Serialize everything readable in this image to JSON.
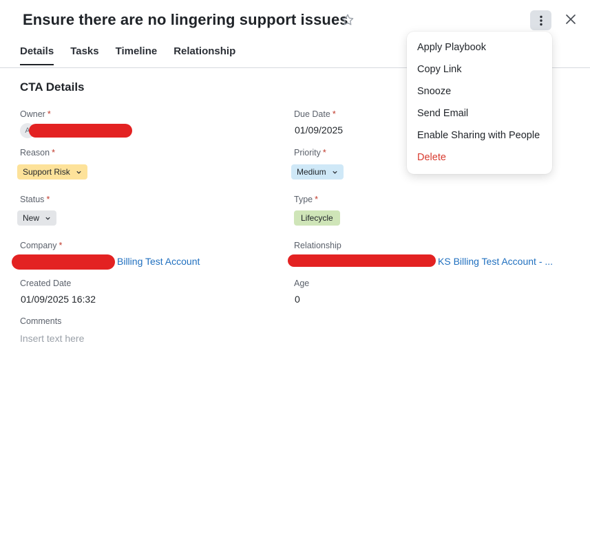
{
  "header": {
    "title": "Ensure there are no lingering support issues",
    "star_icon": "star-outline-icon",
    "more_icon": "more-vertical-icon",
    "close_icon": "close-icon"
  },
  "tabs": [
    {
      "label": "Details",
      "active": true
    },
    {
      "label": "Tasks",
      "active": false
    },
    {
      "label": "Timeline",
      "active": false
    },
    {
      "label": "Relationship",
      "active": false
    }
  ],
  "section": {
    "title": "CTA Details"
  },
  "fields": {
    "owner": {
      "label": "Owner",
      "required_mark": "*",
      "avatar_initial": "A"
    },
    "due_date": {
      "label": "Due Date",
      "required_mark": "*",
      "value": "01/09/2025"
    },
    "reason": {
      "label": "Reason",
      "required_mark": "*",
      "value": "Support Risk"
    },
    "priority": {
      "label": "Priority",
      "required_mark": "*",
      "value": "Medium"
    },
    "status": {
      "label": "Status",
      "required_mark": "*",
      "value": "New"
    },
    "type": {
      "label": "Type",
      "required_mark": "*",
      "value": "Lifecycle"
    },
    "company": {
      "label": "Company",
      "required_mark": "*",
      "value": "Billing Test Account"
    },
    "relationship": {
      "label": "Relationship",
      "value": "KS Billing Test Account - ..."
    },
    "created_date": {
      "label": "Created Date",
      "value": "01/09/2025 16:32"
    },
    "age": {
      "label": "Age",
      "value": "0"
    },
    "comments": {
      "label": "Comments",
      "placeholder": "Insert text here"
    }
  },
  "menu": {
    "items": [
      {
        "label": "Apply Playbook"
      },
      {
        "label": "Copy Link"
      },
      {
        "label": "Snooze"
      },
      {
        "label": "Send Email"
      },
      {
        "label": "Enable Sharing with People"
      },
      {
        "label": "Delete",
        "danger": true
      }
    ]
  },
  "colors": {
    "link": "#1f6fbf",
    "danger": "#d83a2e",
    "chip_reason": "#fde29a",
    "chip_priority": "#cfe8f7",
    "chip_status": "#e3e5e8",
    "chip_type": "#cfe5b8",
    "redaction": "#e32222"
  }
}
